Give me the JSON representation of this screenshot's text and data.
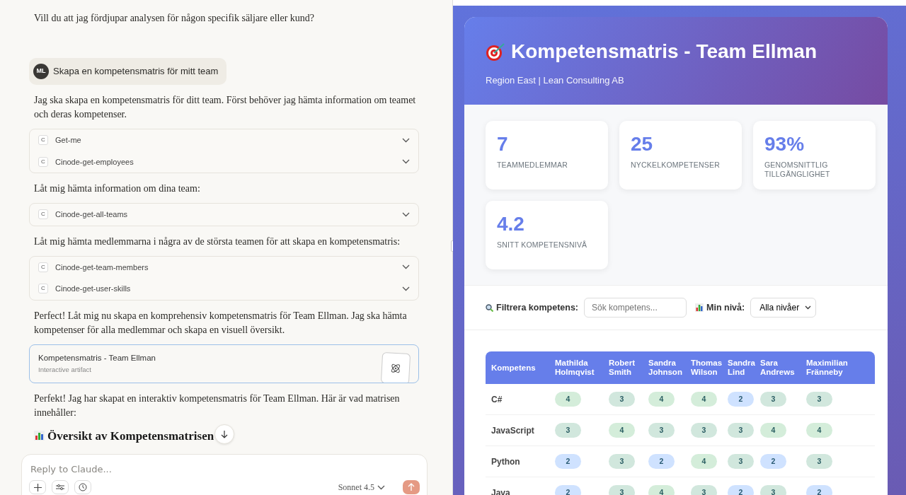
{
  "chat": {
    "messages": [
      {
        "kind": "text",
        "text": "Vill du att jag fördjupar analysen för någon specifik säljare eller kund?"
      },
      {
        "kind": "user",
        "initials": "ML",
        "text": "Skapa en kompetensmatris för mitt team"
      },
      {
        "kind": "text",
        "text": "Jag ska skapa en kompetensmatris för ditt team. Först behöver jag hämta information om teamet och deras kompetenser."
      },
      {
        "kind": "tools",
        "items": [
          {
            "badge": "C",
            "name": "Get-me"
          },
          {
            "badge": "C",
            "name": "Cinode-get-employees"
          }
        ]
      },
      {
        "kind": "text",
        "text": "Låt mig hämta information om dina team:"
      },
      {
        "kind": "tools",
        "items": [
          {
            "badge": "C",
            "name": "Cinode-get-all-teams"
          }
        ]
      },
      {
        "kind": "text",
        "text": "Låt mig hämta medlemmarna i några av de största teamen för att skapa en kompetensmatris:"
      },
      {
        "kind": "tools",
        "items": [
          {
            "badge": "C",
            "name": "Cinode-get-team-members"
          },
          {
            "badge": "C",
            "name": "Cinode-get-user-skills"
          }
        ]
      },
      {
        "kind": "text",
        "text": "Perfect! Låt mig nu skapa en komprehensiv kompetensmatris för Team Ellman. Jag ska hämta kompetenser för alla medlemmar och skapa en visuell översikt."
      },
      {
        "kind": "artifact",
        "title": "Kompetensmatris - Team Ellman",
        "subtitle": "Interactive artifact"
      },
      {
        "kind": "text",
        "text": "Perfekt! Jag har skapat en interaktiv kompetensmatris för Team Ellman. Här är vad matrisen innehåller:"
      },
      {
        "kind": "heading",
        "text": "Översikt av Kompetensmatrisen"
      }
    ],
    "composer": {
      "placeholder": "Reply to Claude...",
      "model": "Sonnet 4.5"
    }
  },
  "artifact": {
    "title": "Kompetensmatris - Team Ellman",
    "subtitle": "Region East | Lean Consulting AB",
    "stats": [
      {
        "value": "7",
        "label": "TEAMMEDLEMMAR"
      },
      {
        "value": "25",
        "label": "NYCKELKOMPETENSER"
      },
      {
        "value": "93%",
        "label": "GENOMSNITTLIG TILLGÄNGLIGHET"
      },
      {
        "value": "4.2",
        "label": "SNITT KOMPETENSNIVÅ"
      }
    ],
    "filter": {
      "label": "Filtrera kompetens:",
      "placeholder": "Sök kompetens...",
      "level_label": "Min nivå:",
      "level_value": "Alla nivåer"
    },
    "table": {
      "columns": [
        "Kompetens",
        "Mathilda Holmqvist",
        "Robert Smith",
        "Sandra Johnson",
        "Thomas Wilson",
        "Sandra Lind",
        "Sara Andrews",
        "Maximilian Fränneby"
      ],
      "rows": [
        {
          "cells": [
            {
              "kind": "skill",
              "value": "C#"
            },
            {
              "kind": "level",
              "value": "4",
              "color": "#d4edda"
            },
            {
              "kind": "level",
              "value": "3",
              "color": "#d1e7dd"
            },
            {
              "kind": "level",
              "value": "4",
              "color": "#d4edda"
            },
            {
              "kind": "level",
              "value": "4",
              "color": "#d4edda"
            },
            {
              "kind": "level",
              "value": "2",
              "color": "#cfe2ff"
            },
            {
              "kind": "level",
              "value": "3",
              "color": "#d1e7dd"
            },
            {
              "kind": "level",
              "value": "3",
              "color": "#d1e7dd"
            }
          ]
        },
        {
          "cells": [
            {
              "kind": "skill",
              "value": "JavaScript"
            },
            {
              "kind": "level",
              "value": "3",
              "color": "#d1e7dd"
            },
            {
              "kind": "level",
              "value": "4",
              "color": "#d4edda"
            },
            {
              "kind": "level",
              "value": "3",
              "color": "#d1e7dd"
            },
            {
              "kind": "level",
              "value": "3",
              "color": "#d1e7dd"
            },
            {
              "kind": "level",
              "value": "3",
              "color": "#d1e7dd"
            },
            {
              "kind": "level",
              "value": "4",
              "color": "#d4edda"
            },
            {
              "kind": "level",
              "value": "4",
              "color": "#d4edda"
            }
          ]
        },
        {
          "cells": [
            {
              "kind": "skill",
              "value": "Python"
            },
            {
              "kind": "level",
              "value": "2",
              "color": "#cfe2ff"
            },
            {
              "kind": "level",
              "value": "3",
              "color": "#d1e7dd"
            },
            {
              "kind": "level",
              "value": "2",
              "color": "#cfe2ff"
            },
            {
              "kind": "level",
              "value": "4",
              "color": "#d4edda"
            },
            {
              "kind": "level",
              "value": "3",
              "color": "#d1e7dd"
            },
            {
              "kind": "level",
              "value": "2",
              "color": "#cfe2ff"
            },
            {
              "kind": "level",
              "value": "3",
              "color": "#d1e7dd"
            }
          ]
        },
        {
          "cells": [
            {
              "kind": "skill",
              "value": "Java"
            },
            {
              "kind": "level",
              "value": "2",
              "color": "#cfe2ff"
            },
            {
              "kind": "level",
              "value": "3",
              "color": "#d1e7dd"
            },
            {
              "kind": "level",
              "value": "4",
              "color": "#d4edda"
            },
            {
              "kind": "level",
              "value": "3",
              "color": "#d1e7dd"
            },
            {
              "kind": "level",
              "value": "2",
              "color": "#cfe2ff"
            },
            {
              "kind": "level",
              "value": "3",
              "color": "#d1e7dd"
            },
            {
              "kind": "level",
              "value": "2",
              "color": "#cfe2ff"
            }
          ]
        }
      ]
    }
  }
}
